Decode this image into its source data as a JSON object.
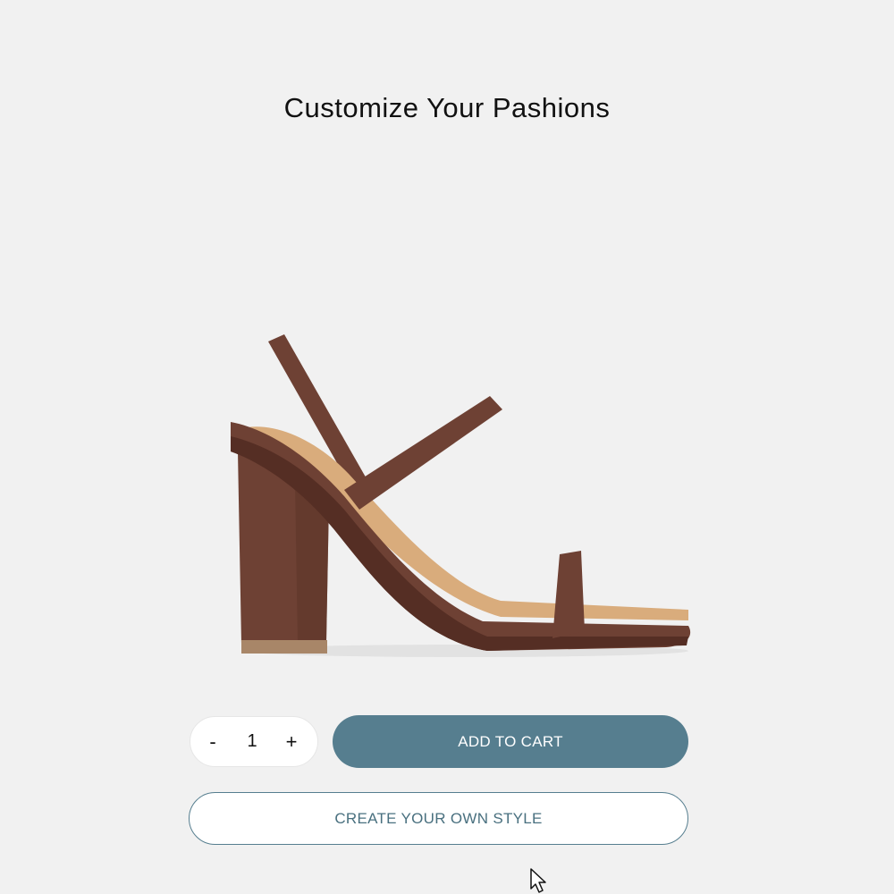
{
  "page": {
    "title": "Customize Your Pashions"
  },
  "product": {
    "image_icon": "block-heel-strappy-sandal",
    "colors": {
      "leather": "#6e4134",
      "leather_dark": "#552e24",
      "insole": "#d9ac7c",
      "heel_tip": "#a88668"
    }
  },
  "quantity": {
    "decrement_label": "-",
    "value": "1",
    "increment_label": "+"
  },
  "actions": {
    "add_to_cart_label": "ADD TO CART",
    "create_style_label": "CREATE YOUR OWN STYLE"
  },
  "theme": {
    "background": "#f1f1f1",
    "accent": "#567e8f",
    "outline_text": "#49707f"
  },
  "pointer": {
    "icon": "mouse-pointer-icon"
  }
}
